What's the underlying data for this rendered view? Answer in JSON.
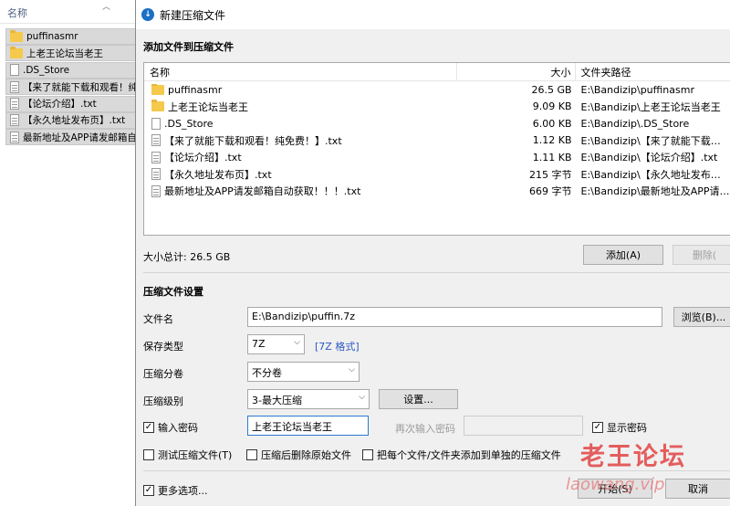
{
  "explorer": {
    "header": "名称",
    "items": [
      {
        "name": "puffinasmr",
        "icon": "folder-icon"
      },
      {
        "name": "上老王论坛当老王",
        "icon": "folder-icon"
      },
      {
        "name": ".DS_Store",
        "icon": "file-icon"
      },
      {
        "name": "【来了就能下载和观看！纯",
        "icon": "text-file-icon"
      },
      {
        "name": "【论坛介绍】.txt",
        "icon": "text-file-icon"
      },
      {
        "name": "【永久地址发布页】.txt",
        "icon": "text-file-icon"
      },
      {
        "name": "最新地址及APP请发邮箱自",
        "icon": "text-file-icon"
      }
    ]
  },
  "dialog": {
    "title": "新建压缩文件",
    "add_section_title": "添加文件到压缩文件",
    "columns": {
      "name": "名称",
      "size": "大小",
      "path": "文件夹路径"
    },
    "files": [
      {
        "name": "puffinasmr",
        "size": "26.5 GB",
        "path": "E:\\Bandizip\\puffinasmr",
        "icon": "folder-icon"
      },
      {
        "name": "上老王论坛当老王",
        "size": "9.09 KB",
        "path": "E:\\Bandizip\\上老王论坛当老王",
        "icon": "folder-icon"
      },
      {
        "name": ".DS_Store",
        "size": "6.00 KB",
        "path": "E:\\Bandizip\\.DS_Store",
        "icon": "file-icon"
      },
      {
        "name": "【来了就能下载和观看！纯免费！】.txt",
        "size": "1.12 KB",
        "path": "E:\\Bandizip\\【来了就能下载和观看！纯免费！】.t...",
        "icon": "text-file-icon"
      },
      {
        "name": "【论坛介绍】.txt",
        "size": "1.11 KB",
        "path": "E:\\Bandizip\\【论坛介绍】.txt",
        "icon": "text-file-icon"
      },
      {
        "name": "【永久地址发布页】.txt",
        "size": "215 字节",
        "path": "E:\\Bandizip\\【永久地址发布页】.txt",
        "icon": "text-file-icon"
      },
      {
        "name": "最新地址及APP请发邮箱自动获取！！！.txt",
        "size": "669 字节",
        "path": "E:\\Bandizip\\最新地址及APP请发邮箱自动获取！...",
        "icon": "text-file-icon"
      }
    ],
    "total_size": "大小总计: 26.5 GB",
    "add_button": "添加(A)",
    "delete_button": "删除(",
    "settings_title": "压缩文件设置",
    "filename_label": "文件名",
    "filename_value": "E:\\Bandizip\\puffin.7z",
    "browse_button": "浏览(B)...",
    "save_type_label": "保存类型",
    "save_type_value": "7Z",
    "format_link": "[7Z 格式]",
    "split_label": "压缩分卷",
    "split_value": "不分卷",
    "level_label": "压缩级别",
    "level_value": "3-最大压缩",
    "settings_button": "设置...",
    "password_label": "输入密码",
    "password_checked": true,
    "password_value": "上老王论坛当老王",
    "reenter_label": "再次输入密码",
    "show_password_label": "显示密码",
    "show_password_checked": true,
    "test_label": "测试压缩文件(T)",
    "delete_original_label": "压缩后删除原始文件",
    "separate_label": "把每个文件/文件夹添加到单独的压缩文件",
    "more_options_label": "更多选项...",
    "more_options_checked": true,
    "start_button": "开始(S)",
    "cancel_button": "取消"
  },
  "watermark": {
    "text": "老王论坛",
    "url": "laowang.vip"
  }
}
